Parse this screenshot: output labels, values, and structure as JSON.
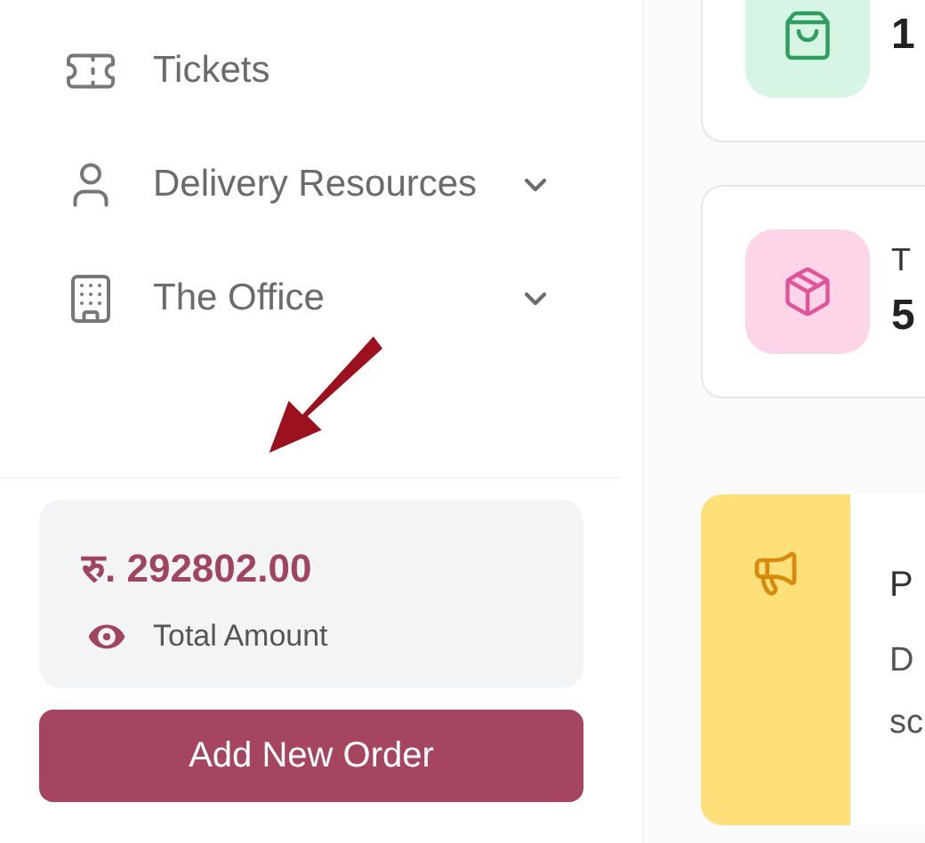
{
  "sidebar": {
    "items": [
      {
        "kind": "link",
        "label": "Tickets"
      },
      {
        "kind": "group",
        "label": "Delivery Resources",
        "expanded": false
      },
      {
        "kind": "group",
        "label": "The Office",
        "expanded": false
      }
    ],
    "total": {
      "amount": "रु. 292802.00",
      "label": "Total Amount"
    },
    "button": "Add New Order"
  },
  "stats": [
    {
      "color": "#d7f5e4",
      "value": "1"
    },
    {
      "color": "#fcd5e8",
      "title": "T",
      "value": "5"
    }
  ],
  "notice": {
    "title": "P",
    "lines": [
      "D",
      "sc"
    ]
  }
}
